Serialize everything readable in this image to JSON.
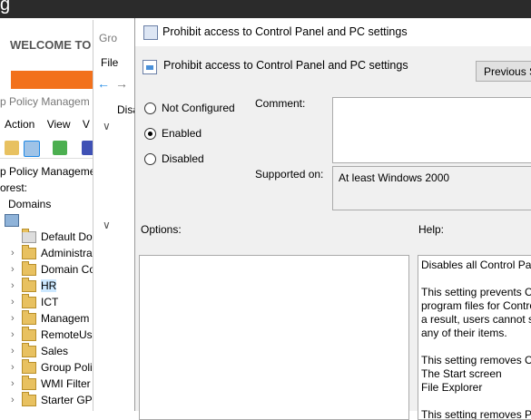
{
  "server_manager": {
    "title_glyph": "g",
    "welcome": "WELCOME TO"
  },
  "gpmc": {
    "title": "p Policy Managem",
    "menu": [
      "Action",
      "View",
      "V"
    ],
    "tree": {
      "root": "p Policy Manageme",
      "forest": "orest:",
      "domains": "Domains",
      "items": [
        "Default Do",
        "Administra",
        "Domain Co",
        "HR",
        "ICT",
        "Managem",
        "RemoteUs",
        "Sales",
        "Group Poli",
        "WMI Filter",
        "Starter GPC"
      ]
    }
  },
  "gpme": {
    "title": "Gro",
    "menu": "File",
    "tree_label": "Disa"
  },
  "dialog": {
    "title": "Prohibit access to Control Panel and PC settings",
    "policy_name": "Prohibit access to Control Panel and PC settings",
    "previous_button": "Previous S",
    "options": {
      "not_configured": "Not Configured",
      "enabled": "Enabled",
      "disabled": "Disabled",
      "selected": "enabled"
    },
    "comment_label": "Comment:",
    "supported_label": "Supported on:",
    "supported_value": "At least Windows 2000",
    "options_label": "Options:",
    "help_label": "Help:",
    "help_lines": [
      "Disables all Control Pan",
      "",
      "This setting prevents Co",
      "program files for Contro",
      "a result, users cannot st",
      "any of their items.",
      "",
      "This setting removes Co",
      "The Start screen",
      "File Explorer",
      "",
      "This setting removes P"
    ]
  }
}
